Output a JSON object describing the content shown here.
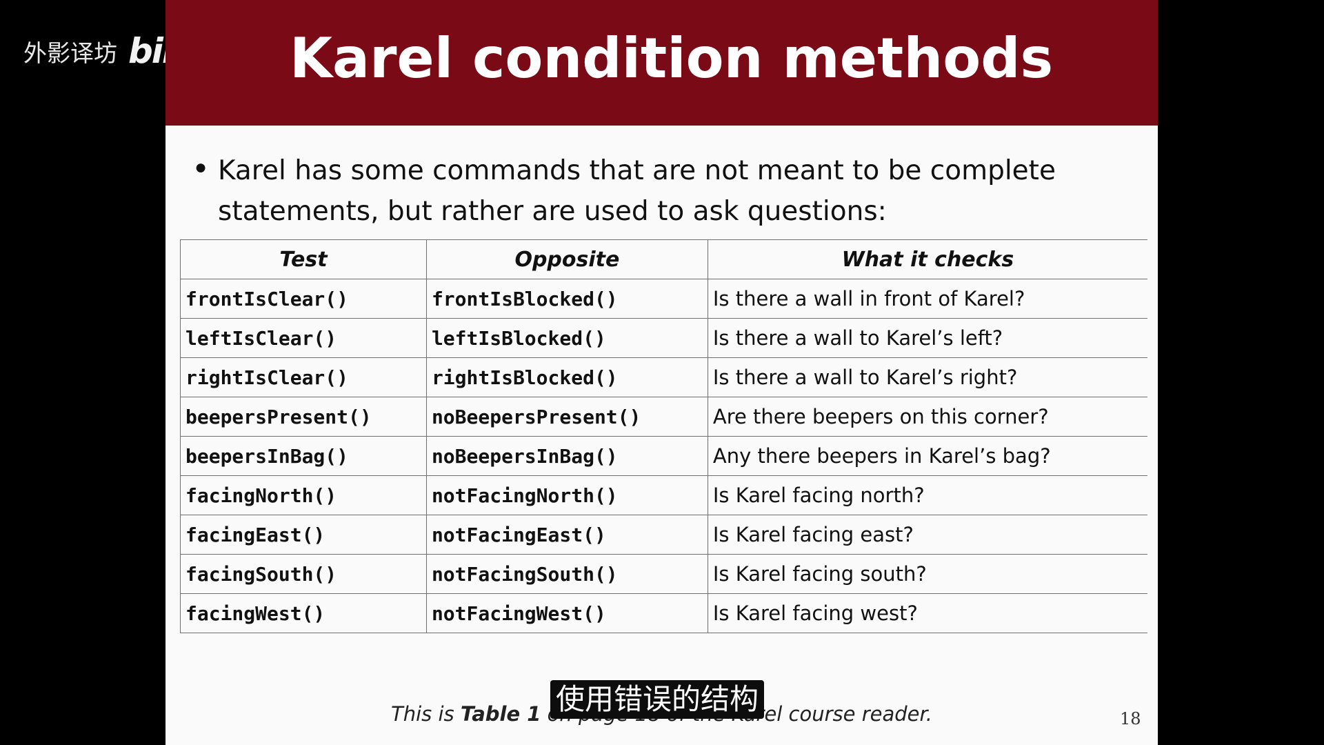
{
  "watermark": {
    "text": "外影译坊",
    "logo": "bilibili"
  },
  "slide": {
    "title": "Karel condition methods",
    "bullet": "Karel has some commands that are not meant to be complete statements, but rather are used to ask questions:",
    "table": {
      "headers": [
        "Test",
        "Opposite",
        "What it checks"
      ],
      "rows": [
        {
          "test": "frontIsClear()",
          "opposite": "frontIsBlocked()",
          "checks": "Is there a wall in front of Karel?"
        },
        {
          "test": "leftIsClear()",
          "opposite": "leftIsBlocked()",
          "checks": "Is there a wall to Karel’s left?"
        },
        {
          "test": "rightIsClear()",
          "opposite": "rightIsBlocked()",
          "checks": "Is there a wall to Karel’s right?"
        },
        {
          "test": "beepersPresent()",
          "opposite": "noBeepersPresent()",
          "checks": "Are there beepers on this corner?"
        },
        {
          "test": "beepersInBag()",
          "opposite": "noBeepersInBag()",
          "checks": "Any there beepers in Karel’s bag?"
        },
        {
          "test": "facingNorth()",
          "opposite": "notFacingNorth()",
          "checks": "Is Karel facing north?"
        },
        {
          "test": "facingEast()",
          "opposite": "notFacingEast()",
          "checks": "Is Karel facing east?"
        },
        {
          "test": "facingSouth()",
          "opposite": "notFacingSouth()",
          "checks": "Is Karel facing south?"
        },
        {
          "test": "facingWest()",
          "opposite": "notFacingWest()",
          "checks": "Is Karel facing west?"
        }
      ]
    },
    "footer": {
      "prefix": "This is ",
      "bold": "Table 1",
      "suffix": " on page 18 of the Karel course reader."
    },
    "page_number": "18"
  },
  "subtitle": "使用错误的结构",
  "colors": {
    "title_bar": "#7b0a17",
    "background": "#000000",
    "slide": "#fafafa"
  }
}
